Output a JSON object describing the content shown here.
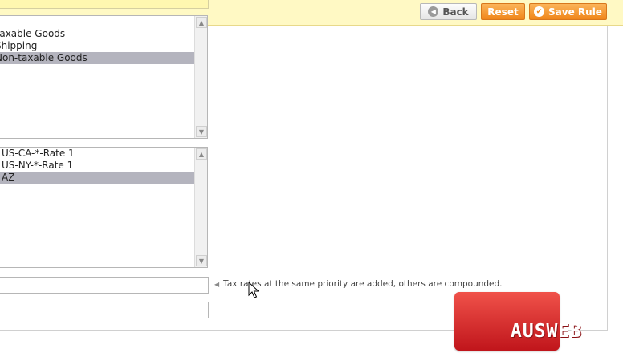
{
  "toolbar": {
    "back_label": "Back",
    "reset_label": "Reset",
    "save_label": "Save Rule"
  },
  "product_tax_class": {
    "options": [
      {
        "label": "Taxable Goods",
        "selected": false
      },
      {
        "label": "Shipping",
        "selected": false
      },
      {
        "label": "Non-taxable Goods",
        "selected": true
      }
    ]
  },
  "tax_rate": {
    "options": [
      {
        "label": "US-CA-*-Rate 1",
        "selected": false
      },
      {
        "label": "US-NY-*-Rate 1",
        "selected": false
      },
      {
        "label": "AZ",
        "selected": true
      }
    ]
  },
  "priority": {
    "value": "",
    "note": "Tax rates at the same priority are added, others are compounded."
  },
  "sort_order": {
    "value": ""
  },
  "watermark": {
    "text": "AUSWEB"
  },
  "colors": {
    "header_bg": "#fff9c4",
    "button_orange": "#f0861a",
    "selected_option": "#b4b4be",
    "logo_red": "#d9232a"
  }
}
